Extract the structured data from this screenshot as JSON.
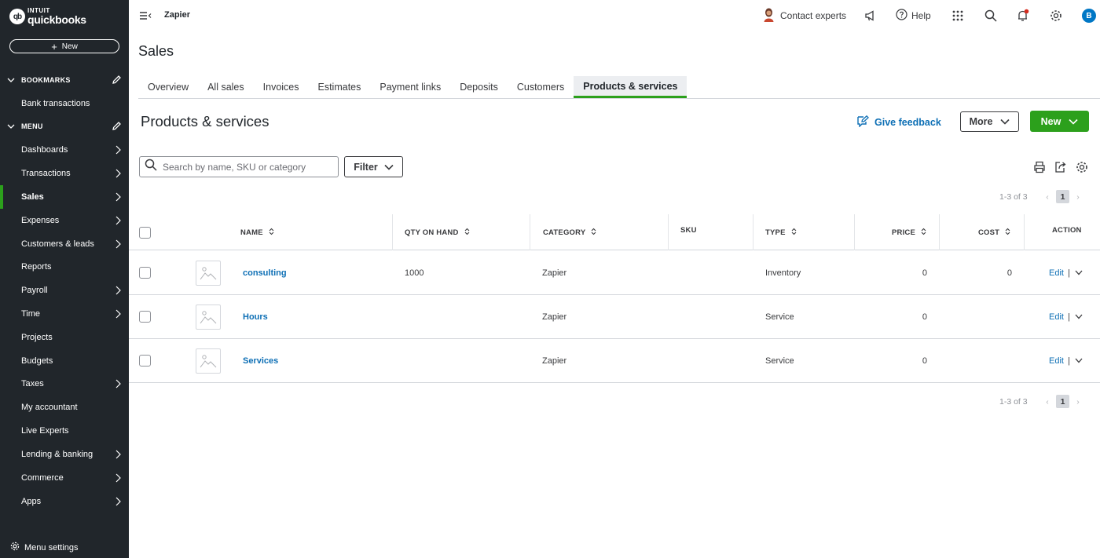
{
  "brand": {
    "small": "INTUIT",
    "big": "quickbooks",
    "mark": "qb"
  },
  "sidebar": {
    "new_label": "New",
    "bookmarks_label": "BOOKMARKS",
    "bookmarks": [
      {
        "label": "Bank transactions"
      }
    ],
    "menu_label": "MENU",
    "items": [
      {
        "label": "Dashboards"
      },
      {
        "label": "Transactions"
      },
      {
        "label": "Sales"
      },
      {
        "label": "Expenses"
      },
      {
        "label": "Customers & leads"
      },
      {
        "label": "Reports"
      },
      {
        "label": "Payroll"
      },
      {
        "label": "Time"
      },
      {
        "label": "Projects"
      },
      {
        "label": "Budgets"
      },
      {
        "label": "Taxes"
      },
      {
        "label": "My accountant"
      },
      {
        "label": "Live Experts"
      },
      {
        "label": "Lending & banking"
      },
      {
        "label": "Commerce"
      },
      {
        "label": "Apps"
      }
    ],
    "menu_settings": "Menu settings"
  },
  "header": {
    "company": "Zapier",
    "contact": "Contact experts",
    "help": "Help",
    "user_initial": "B"
  },
  "page": {
    "title": "Sales",
    "tabs": [
      {
        "label": "Overview"
      },
      {
        "label": "All sales"
      },
      {
        "label": "Invoices"
      },
      {
        "label": "Estimates"
      },
      {
        "label": "Payment links"
      },
      {
        "label": "Deposits"
      },
      {
        "label": "Customers"
      },
      {
        "label": "Products & services"
      }
    ],
    "section_title": "Products & services",
    "feedback": "Give feedback",
    "more": "More",
    "new": "New",
    "search_placeholder": "Search by name, SKU or category",
    "filter": "Filter"
  },
  "pager": {
    "range": "1-3 of 3",
    "current": "1"
  },
  "table": {
    "headers": {
      "name": "NAME",
      "qty": "QTY ON HAND",
      "category": "CATEGORY",
      "sku": "SKU",
      "type": "TYPE",
      "price": "PRICE",
      "cost": "COST",
      "action": "ACTION"
    },
    "rows": [
      {
        "name": "consulting",
        "qty": "1000",
        "category": "Zapier",
        "sku": "",
        "type": "Inventory",
        "price": "0",
        "cost": "0",
        "action": "Edit"
      },
      {
        "name": "Hours",
        "qty": "",
        "category": "Zapier",
        "sku": "",
        "type": "Service",
        "price": "0",
        "cost": "",
        "action": "Edit"
      },
      {
        "name": "Services",
        "qty": "",
        "category": "Zapier",
        "sku": "",
        "type": "Service",
        "price": "0",
        "cost": "",
        "action": "Edit"
      }
    ]
  },
  "colors": {
    "accent_green": "#2ca01c",
    "link_blue": "#0d6fb5",
    "sidebar_bg": "#21262b"
  }
}
